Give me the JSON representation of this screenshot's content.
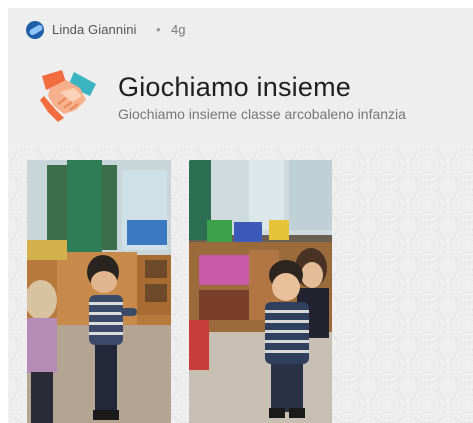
{
  "post": {
    "author": "Linda Giannini",
    "separator": "•",
    "time": "4g"
  },
  "app": {
    "logo_icon": "handshake-icon",
    "title": "Giochiamo insieme",
    "subtitle": "Giochiamo insieme classe arcobaleno infanzia"
  },
  "gallery": {
    "photos": [
      {
        "name": "children-playing-photo-1"
      },
      {
        "name": "children-playing-photo-2"
      }
    ]
  },
  "colors": {
    "card_bg": "#eeeeee",
    "logo_orange": "#f26d3d",
    "logo_teal": "#3bb4c1",
    "title_text": "#202020",
    "meta_text": "#777777"
  }
}
